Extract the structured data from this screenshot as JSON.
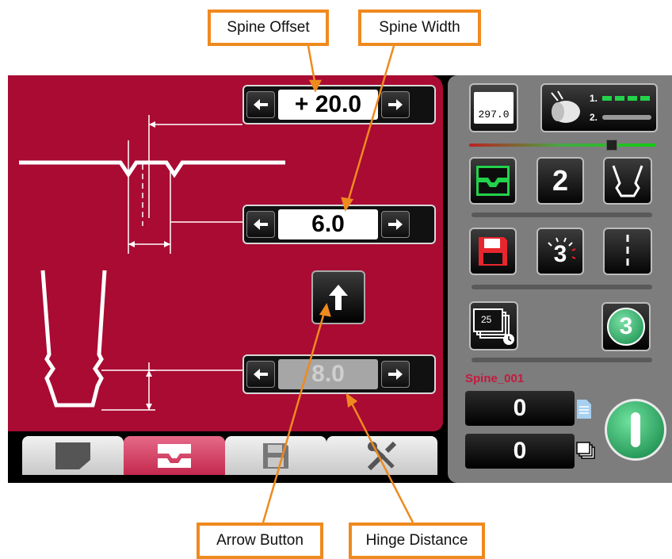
{
  "callouts": {
    "spine_offset": "Spine Offset",
    "spine_width": "Spine Width",
    "arrow_button": "Arrow Button",
    "hinge_distance": "Hinge Distance"
  },
  "steppers": {
    "spine_offset_value": "+ 20.0",
    "spine_width_value": "6.0",
    "hinge_distance_value": "8.0"
  },
  "right_panel": {
    "paper_size": "297.0",
    "count_number": "2",
    "speed_number": "3",
    "mode_number": "3",
    "batch_number": "25",
    "dots_1": "1.",
    "dots_2": "2.",
    "job_name": "Spine_001",
    "counter_top": "0",
    "counter_bottom": "0"
  },
  "colors": {
    "panel_red": "#a90b33",
    "callout_orange": "#ef8a1e",
    "accent_green": "#22d24a",
    "start_green": "#1fa053"
  },
  "icons": [
    "left-arrow-icon",
    "right-arrow-icon",
    "up-arrow-icon",
    "document-tab-icon",
    "spine-tab-icon",
    "save-tab-icon",
    "tools-tab-icon",
    "paper-size-icon",
    "feed-roller-icon",
    "spine-mode-icon",
    "cutter-icon",
    "save-icon",
    "speed-icon",
    "perforation-icon",
    "batch-timer-icon",
    "mode-badge-icon",
    "document-icon",
    "stack-icon",
    "start-icon"
  ]
}
